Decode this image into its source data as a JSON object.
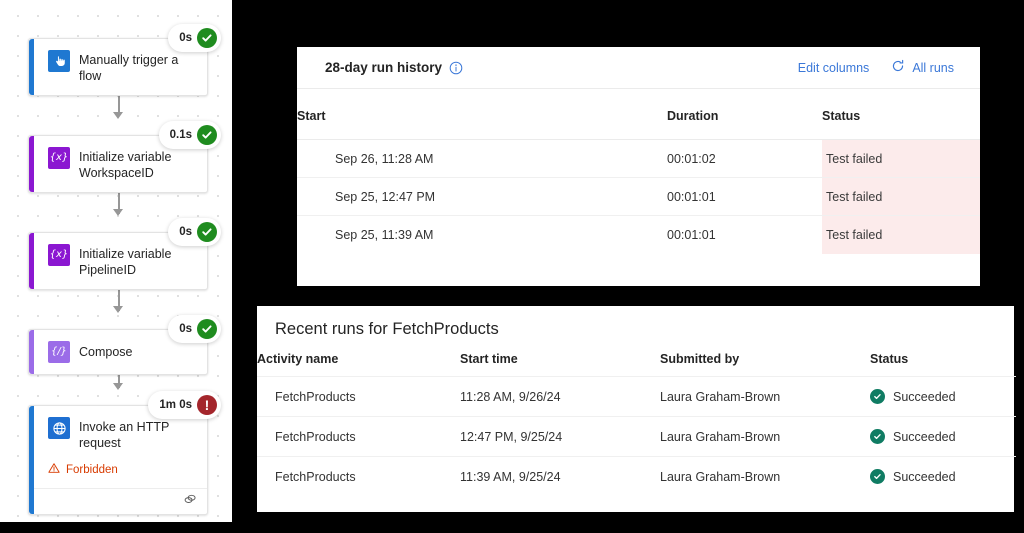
{
  "colors": {
    "trigger_blue": "#1f78d1",
    "variable_purple": "#8b17d1",
    "compose_purple": "#9b6ce8",
    "success_green": "#1f8c1f",
    "error_red": "#a4262c",
    "forbidden_orange": "#d83b01",
    "link_blue": "#3b78d8",
    "failed_bg_pink": "#fcebeb",
    "succeeded_teal": "#107c63"
  },
  "flow": {
    "nodes": [
      {
        "title": "Manually trigger a flow",
        "icon": "manual-trigger-icon",
        "icon_kind": "trigger",
        "accent": "#1f78d1",
        "duration": "0s",
        "state": "success"
      },
      {
        "title": "Initialize variable WorkspaceID",
        "icon": "variable-icon",
        "icon_kind": "variable",
        "glyph": "{x}",
        "accent": "#8b17d1",
        "duration": "0.1s",
        "state": "success"
      },
      {
        "title": "Initialize variable PipelineID",
        "icon": "variable-icon",
        "icon_kind": "variable",
        "glyph": "{x}",
        "accent": "#8b17d1",
        "duration": "0s",
        "state": "success"
      },
      {
        "title": "Compose",
        "icon": "compose-icon",
        "icon_kind": "compose",
        "glyph": "{/}",
        "accent": "#9b6ce8",
        "duration": "0s",
        "state": "success"
      },
      {
        "title": "Invoke an HTTP request",
        "icon": "globe-icon",
        "icon_kind": "http",
        "accent": "#1f78d1",
        "duration": "1m 0s",
        "state": "error",
        "error_text": "Forbidden",
        "footer_icon": "link-chain-icon"
      }
    ]
  },
  "run_history": {
    "title": "28-day run history",
    "info_icon": "info-icon",
    "edit_columns_label": "Edit columns",
    "all_runs_label": "All runs",
    "refresh_icon": "refresh-icon",
    "columns": [
      "Start",
      "Duration",
      "Status"
    ],
    "rows": [
      {
        "start": "Sep 26, 11:28 AM",
        "duration": "00:01:02",
        "status": "Test failed"
      },
      {
        "start": "Sep 25, 12:47 PM",
        "duration": "00:01:01",
        "status": "Test failed"
      },
      {
        "start": "Sep 25, 11:39 AM",
        "duration": "00:01:01",
        "status": "Test failed"
      }
    ]
  },
  "recent_runs": {
    "title": "Recent runs for FetchProducts",
    "columns": [
      "Activity name",
      "Start time",
      "Submitted by",
      "Status"
    ],
    "rows": [
      {
        "activity": "FetchProducts",
        "start_time": "11:28 AM, 9/26/24",
        "submitted_by": "Laura Graham-Brown",
        "status": "Succeeded"
      },
      {
        "activity": "FetchProducts",
        "start_time": "12:47 PM, 9/25/24",
        "submitted_by": "Laura Graham-Brown",
        "status": "Succeeded"
      },
      {
        "activity": "FetchProducts",
        "start_time": "11:39 AM, 9/25/24",
        "submitted_by": "Laura Graham-Brown",
        "status": "Succeeded"
      }
    ]
  }
}
